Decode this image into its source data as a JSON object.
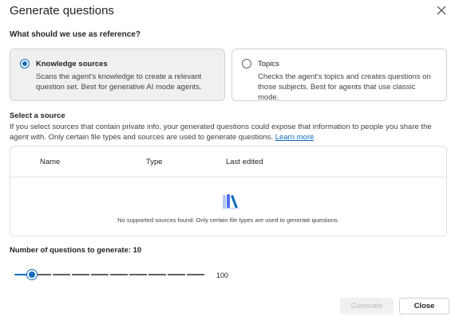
{
  "dialog": {
    "title": "Generate questions",
    "close_icon": "close-icon"
  },
  "reference": {
    "label": "What should we use as reference?",
    "options": [
      {
        "title": "Knowledge sources",
        "description": "Scans the agent's knowledge to create a relevant question set. Best for generative AI mode agents.",
        "selected": true
      },
      {
        "title": "Topics",
        "description": "Checks the agent's topics and creates questions on those subjects. Best for agents that use classic mode.",
        "selected": false
      }
    ]
  },
  "source": {
    "title": "Select a source",
    "description": "If you select sources that contain private info, your generated questions could expose that information to people you share the agent with. Only certain file types and sources are used to generate questions.",
    "link": "Learn more",
    "columns": [
      "Name",
      "Type",
      "Last edited"
    ],
    "empty_icon": "books-icon",
    "empty_message": "No supported sources found. Only certain file types are used to generate questions."
  },
  "questions": {
    "label": "Number of questions to generate: 10",
    "value": 10,
    "max_label": "100"
  },
  "footer": {
    "generate_label": "Generate",
    "close_label": "Close"
  },
  "colors": {
    "accent": "#0f6cbd",
    "selected_card_bg": "#f0f0f0"
  }
}
